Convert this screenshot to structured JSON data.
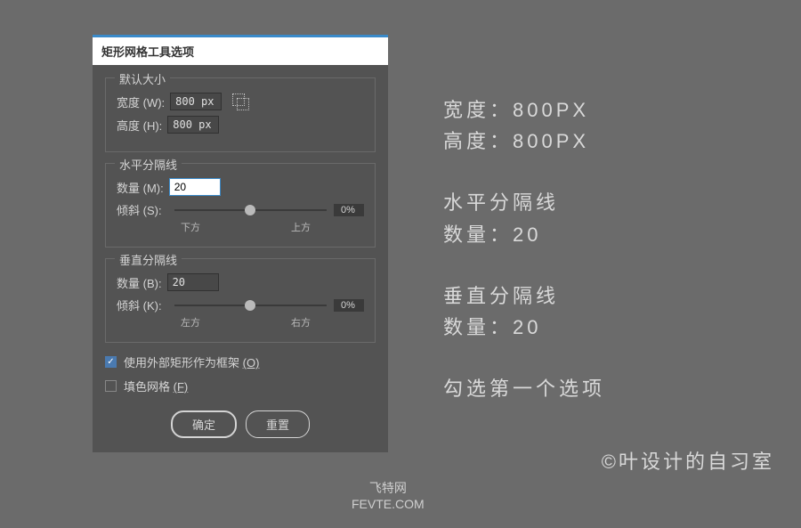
{
  "dialog": {
    "title": "矩形网格工具选项",
    "defaultSize": {
      "title": "默认大小",
      "widthLabel": "宽度 (W):",
      "widthValue": "800 px",
      "heightLabel": "高度 (H):",
      "heightValue": "800 px"
    },
    "horizontal": {
      "title": "水平分隔线",
      "countLabel": "数量 (M):",
      "countValue": "20",
      "skewLabel": "倾斜 (S):",
      "skewValue": "0%",
      "belowLabel": "下方",
      "aboveLabel": "上方"
    },
    "vertical": {
      "title": "垂直分隔线",
      "countLabel": "数量 (B):",
      "countValue": "20",
      "skewLabel": "倾斜 (K):",
      "skewValue": "0%",
      "leftLabel": "左方",
      "rightLabel": "右方"
    },
    "useFrame": "使用外部矩形作为框架 ",
    "useFrameShortcut": "(O)",
    "fillGrid": "填色网格 ",
    "fillGridShortcut": "(F)",
    "okBtn": "确定",
    "resetBtn": "重置"
  },
  "annotations": {
    "widthLine": "宽度：800PX",
    "heightLine": "高度：800PX",
    "hTitle": "水平分隔线",
    "hCount": "数量：20",
    "vTitle": "垂直分隔线",
    "vCount": "数量：20",
    "checkNote": "勾选第一个选项"
  },
  "credit": "©叶设计的自习室",
  "watermark1": "飞特网",
  "watermark2": "FEVTE.COM"
}
